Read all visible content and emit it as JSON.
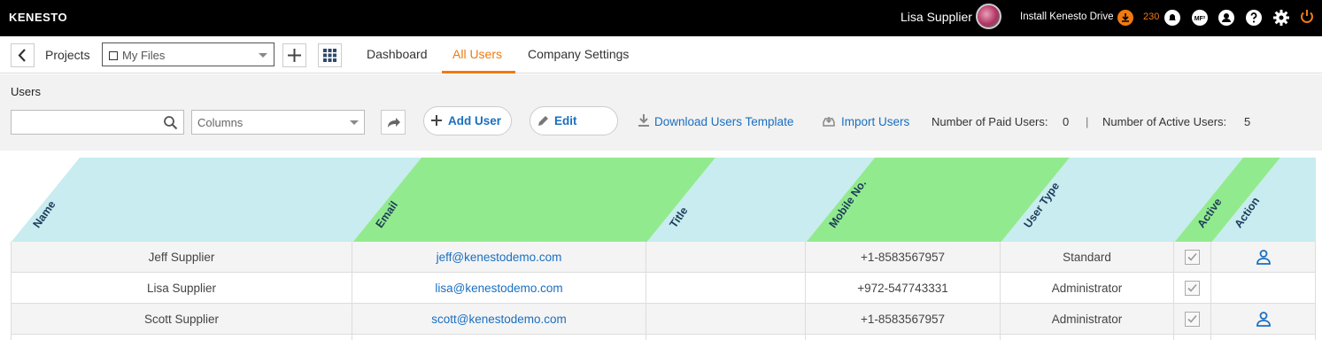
{
  "topbar": {
    "logo": "KENESTO",
    "user_name": "Lisa Supplier",
    "install_label": "Install Kenesto Drive",
    "notif_count": "230",
    "icons": [
      "download-icon",
      "bell-icon",
      "mfa-icon",
      "account-icon",
      "help-icon",
      "settings-icon",
      "power-icon"
    ],
    "mfa_badge": "MF²"
  },
  "nav": {
    "projects_label": "Projects",
    "file_select_value": "My Files",
    "tabs": [
      {
        "label": "Dashboard",
        "active": false
      },
      {
        "label": "All Users",
        "active": true
      },
      {
        "label": "Company Settings",
        "active": false
      }
    ]
  },
  "toolbar": {
    "heading": "Users",
    "search_value": "",
    "columns_placeholder": "Columns",
    "add_user_label": "Add User",
    "edit_label": "Edit",
    "download_template_label": "Download Users Template",
    "import_users_label": "Import Users",
    "paid_users_label": "Number of Paid Users:",
    "paid_users_count": "0",
    "separator": "|",
    "active_users_label": "Number of Active Users:",
    "active_users_count": "5"
  },
  "table": {
    "columns": [
      "Name",
      "Email",
      "Title",
      "Mobile No.",
      "User Type",
      "Active",
      "Action"
    ],
    "rows": [
      {
        "name": "Jeff Supplier",
        "email": "jeff@kenestodemo.com",
        "title": "",
        "mobile": "+1-8583567957",
        "user_type": "Standard",
        "active": true,
        "action": "user-icon"
      },
      {
        "name": "Lisa Supplier",
        "email": "lisa@kenestodemo.com",
        "title": "",
        "mobile": "+972-547743331",
        "user_type": "Administrator",
        "active": true,
        "action": ""
      },
      {
        "name": "Scott Supplier",
        "email": "scott@kenestodemo.com",
        "title": "",
        "mobile": "+1-8583567957",
        "user_type": "Administrator",
        "active": true,
        "action": "user-icon"
      }
    ]
  },
  "colors": {
    "accent": "#f07a10",
    "link": "#1a6fc0",
    "header_cyan": "#c8ecef",
    "header_green": "#92ea8e"
  }
}
